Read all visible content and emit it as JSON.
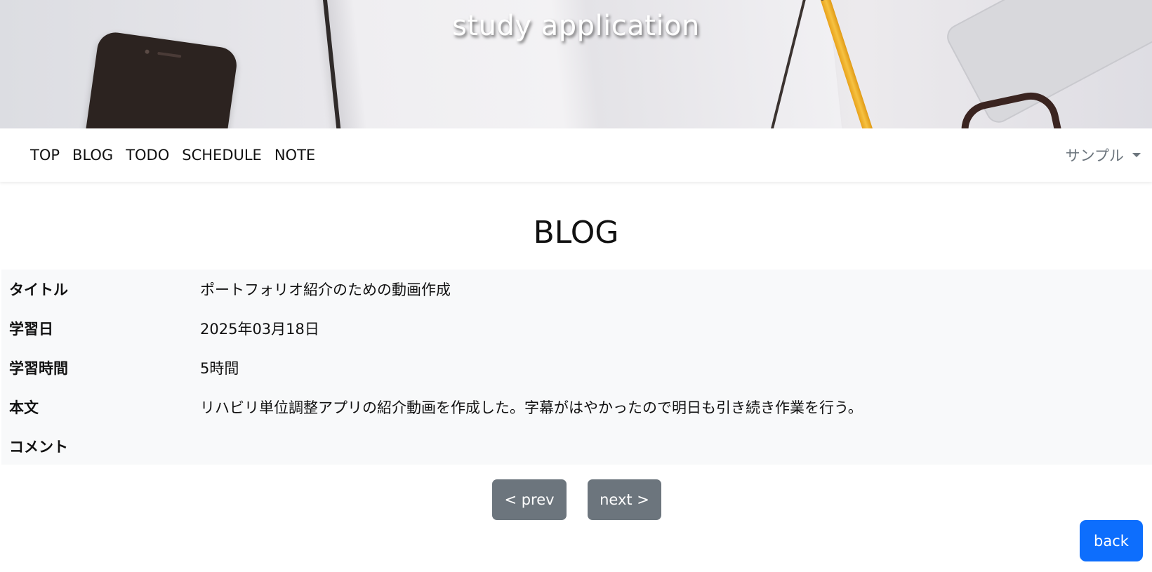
{
  "header": {
    "site_title": "study application"
  },
  "nav": {
    "items": [
      {
        "label": "TOP"
      },
      {
        "label": "BLOG"
      },
      {
        "label": "TODO"
      },
      {
        "label": "SCHEDULE"
      },
      {
        "label": "NOTE"
      }
    ],
    "user_menu_label": "サンプル"
  },
  "page": {
    "title": "BLOG"
  },
  "detail": {
    "rows": [
      {
        "label": "タイトル",
        "value": "ポートフォリオ紹介のための動画作成"
      },
      {
        "label": "学習日",
        "value": "2025年03月18日"
      },
      {
        "label": "学習時間",
        "value": "5時間"
      },
      {
        "label": "本文",
        "value": "リハビリ単位調整アプリの紹介動画を作成した。字幕がはやかったので明日も引き続き作業を行う。"
      },
      {
        "label": "コメント",
        "value": ""
      }
    ]
  },
  "pager": {
    "prev_label": "< prev",
    "next_label": "next >"
  },
  "actions": {
    "back_label": "back"
  },
  "colors": {
    "secondary_button": "#6c757d",
    "primary_button": "#0d6efd",
    "table_background": "#f8f9fa"
  }
}
